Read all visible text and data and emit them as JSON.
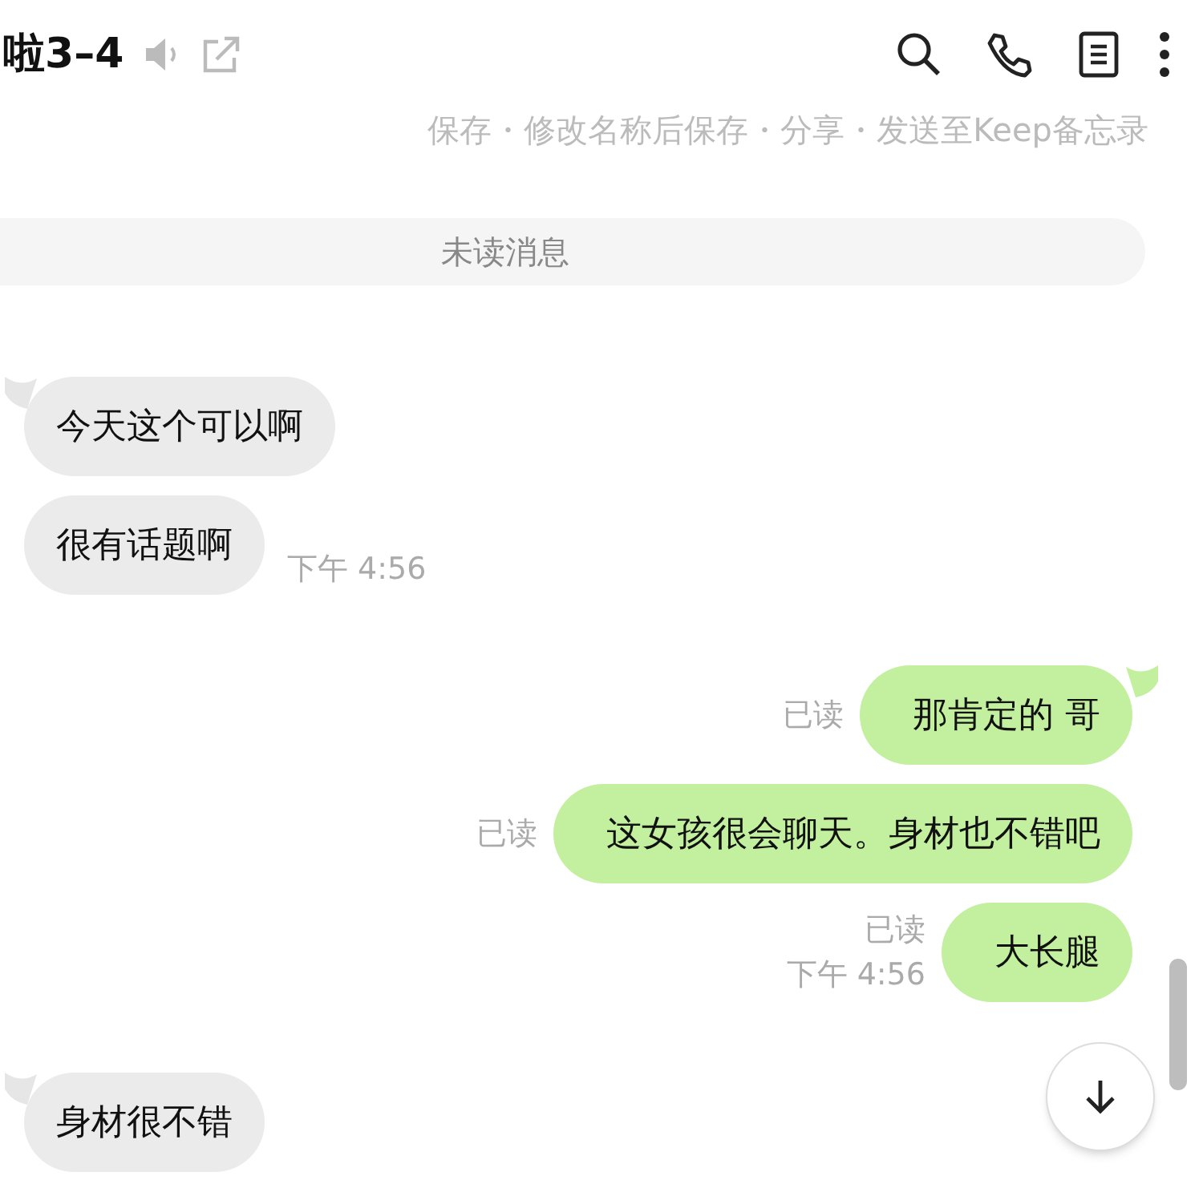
{
  "header": {
    "title": "啦3–4"
  },
  "actions_line": "保存・修改名称后保存・分享・发送至Keep备忘录",
  "unread_divider": "未读消息",
  "messages": [
    {
      "kind": "incoming",
      "text": "今天这个可以啊",
      "tail": true
    },
    {
      "kind": "incoming",
      "text": "很有话题啊",
      "tail": false,
      "time": "下午 4:56"
    },
    {
      "kind": "outgoing",
      "text": "那肯定的 哥",
      "tail": true,
      "read": "已读"
    },
    {
      "kind": "outgoing",
      "text": "这女孩很会聊天。身材也不错吧",
      "tail": false,
      "read": "已读"
    },
    {
      "kind": "outgoing",
      "text": "大长腿",
      "tail": false,
      "read": "已读",
      "time": "下午 4:56"
    },
    {
      "kind": "incoming",
      "text": "身材很不错",
      "tail": true
    }
  ]
}
